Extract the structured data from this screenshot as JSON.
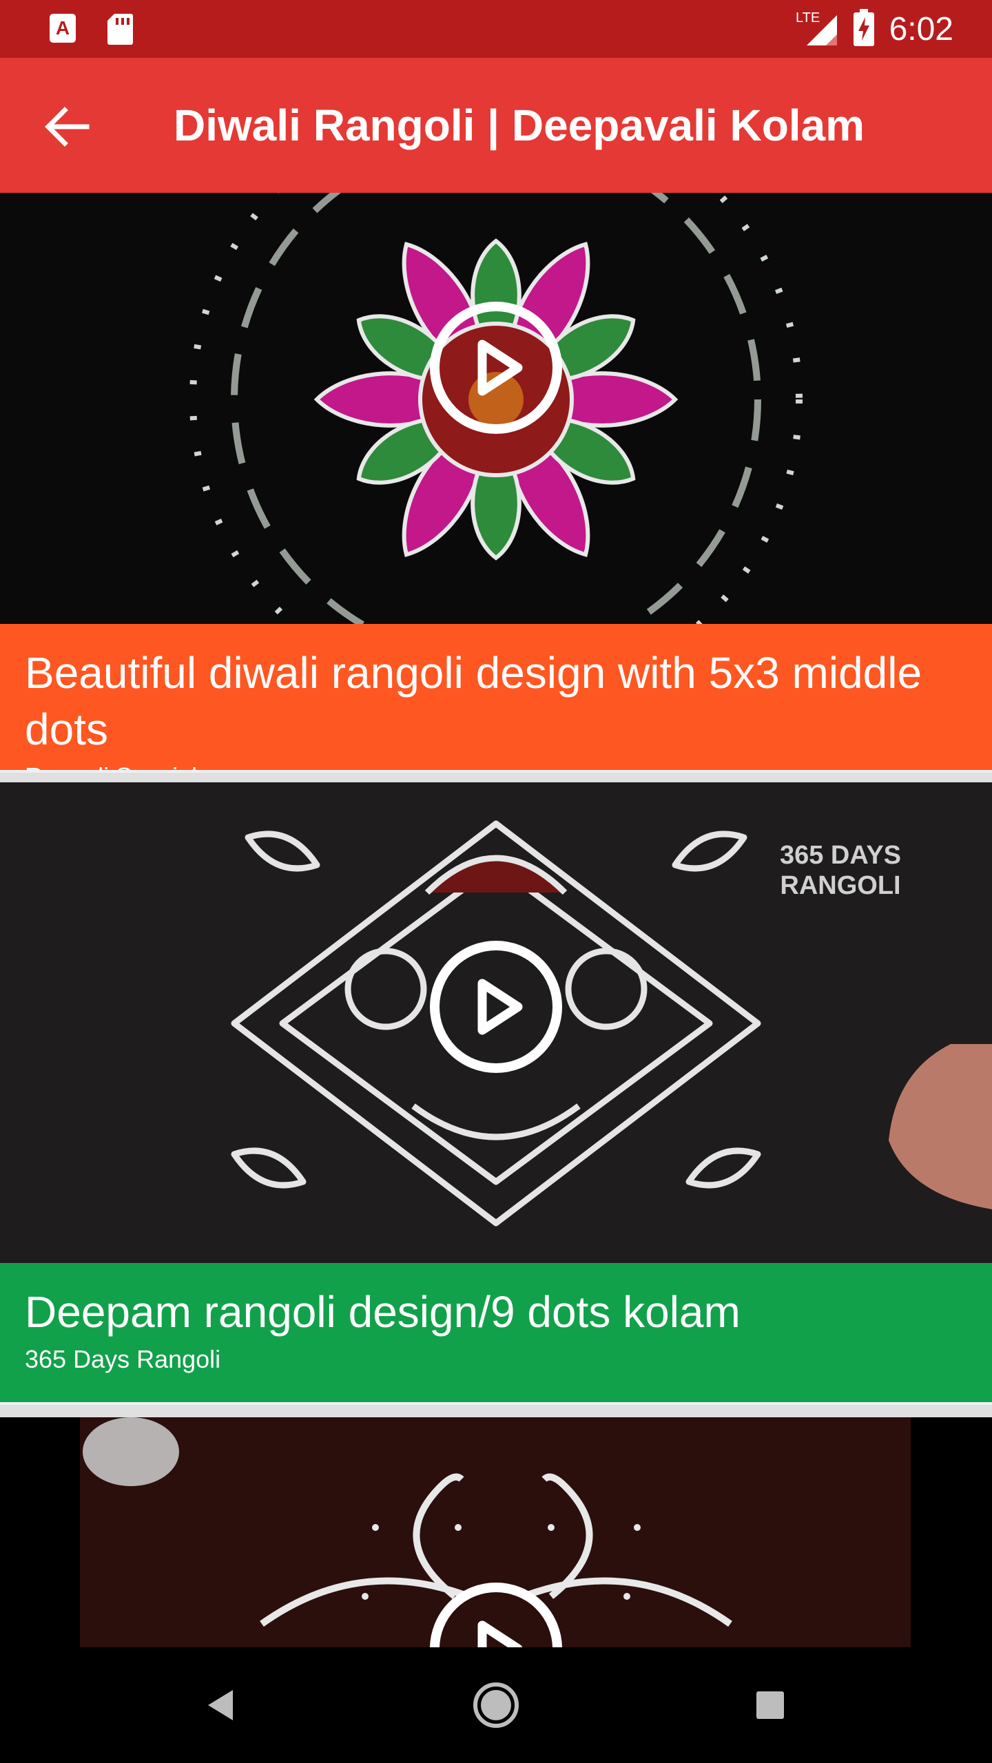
{
  "status_bar": {
    "time": "6:02",
    "network": "LTE",
    "icons": [
      "text-a-notification-icon",
      "sd-card-icon",
      "signal-icon",
      "battery-charging-icon"
    ]
  },
  "app_bar": {
    "title": "Diwali Rangoli | Deepavali Kolam",
    "back_icon": "arrow-back-icon"
  },
  "videos": [
    {
      "title": "Beautiful diwali rangoli design with 5x3 middle dots",
      "channel": "Rangoli Specials",
      "caption_color": "#ff5722",
      "thumbnail_bg": "#0a0a0a"
    },
    {
      "title": "Deepam rangoli design/9 dots kolam",
      "channel": "365 Days Rangoli",
      "caption_color": "#12a14b",
      "thumbnail_bg": "#1e1c1c",
      "thumbnail_overlay_text": "365 DAYS\nRANGOLI"
    },
    {
      "title": "",
      "channel": "",
      "thumbnail_bg": "#2a0f0c"
    }
  ],
  "nav_bar": {
    "back_icon": "nav-back-icon",
    "home_icon": "nav-home-icon",
    "recents_icon": "nav-recents-icon"
  }
}
